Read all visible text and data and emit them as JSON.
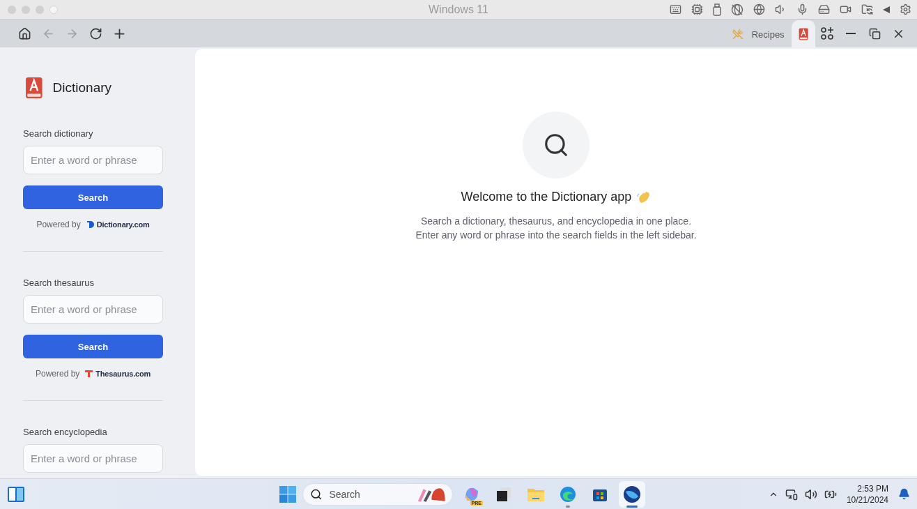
{
  "host_window": {
    "title": "Windows 11"
  },
  "browser": {
    "back_disabled": true,
    "forward_disabled": true,
    "tabs": [
      {
        "kind": "recipes",
        "label": "Recipes",
        "selected": false
      },
      {
        "kind": "dictionary",
        "selected": true
      }
    ]
  },
  "sidebar": {
    "app_title": "Dictionary",
    "sections": [
      {
        "kind": "dictionary",
        "label": "Search dictionary",
        "placeholder": "Enter a word or phrase",
        "button": "Search",
        "powered_by": "Powered by",
        "brand": "Dictionary.com"
      },
      {
        "kind": "thesaurus",
        "label": "Search thesaurus",
        "placeholder": "Enter a word or phrase",
        "button": "Search",
        "powered_by": "Powered by",
        "brand": "Thesaurus.com"
      },
      {
        "label": "Search encyclopedia",
        "placeholder": "Enter a word or phrase"
      }
    ]
  },
  "main": {
    "heading": "Welcome to the Dictionary app",
    "lines": [
      "Search a dictionary, thesaurus, and encyclopedia in one place.",
      "Enter any word or phrase into the search fields in the left sidebar."
    ]
  },
  "taskbar": {
    "search_placeholder": "Search",
    "apps": [
      {
        "kind": "copilot",
        "badge": "PRE",
        "selected": false,
        "running": false
      },
      {
        "kind": "stack",
        "selected": false,
        "running": false
      },
      {
        "kind": "folder",
        "selected": false,
        "running": false
      },
      {
        "kind": "edge",
        "selected": false,
        "running": true
      },
      {
        "kind": "store",
        "selected": false,
        "running": false
      },
      {
        "kind": "sphere",
        "selected": true,
        "running": true
      }
    ],
    "time": "2:53 PM",
    "date": "10/21/2024"
  }
}
